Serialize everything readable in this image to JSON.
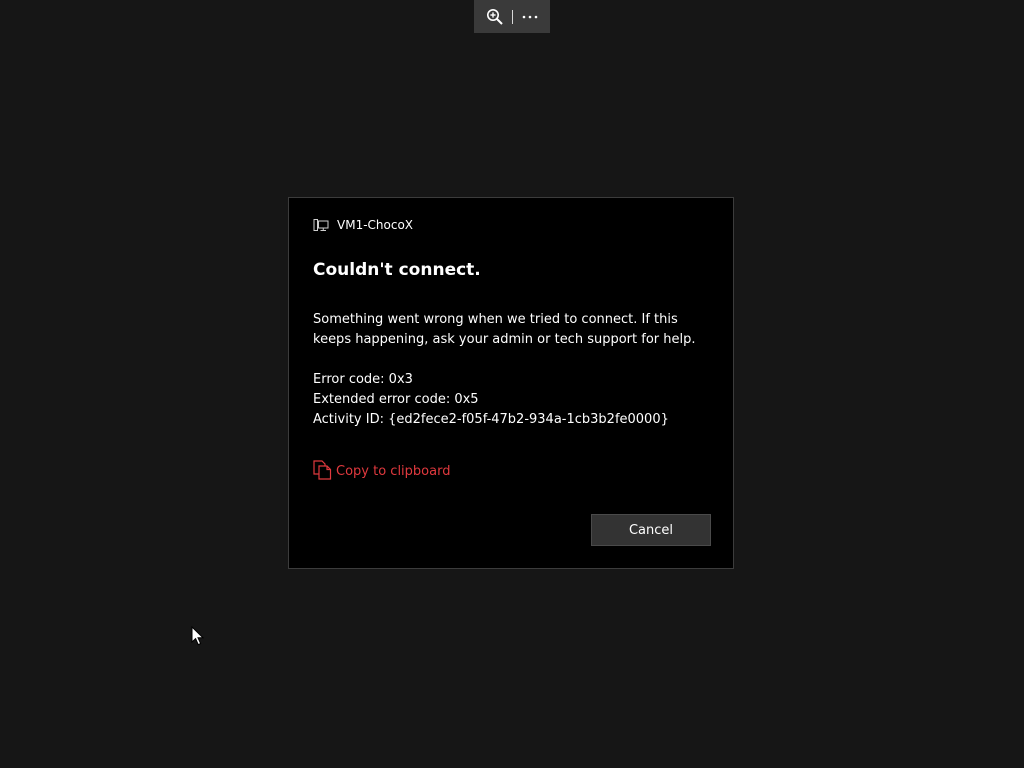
{
  "toolbar": {
    "icons": [
      "zoom-in-icon",
      "more-options-icon"
    ]
  },
  "dialog": {
    "connection_icon": "remote-pc-icon",
    "connection_name": "VM1-ChocoX",
    "title": "Couldn't connect.",
    "message": "Something went wrong when we tried to connect. If this keeps happening, ask your admin or tech support for help.",
    "error_code": "Error code: 0x3",
    "extended_error_code": "Extended error code: 0x5",
    "activity_id": "Activity ID: {ed2fece2-f05f-47b2-934a-1cb3b2fe0000}",
    "copy_icon": "copy-icon",
    "copy_label": "Copy to clipboard",
    "cancel_label": "Cancel"
  },
  "colors": {
    "background": "#161616",
    "dialog_background": "#000000",
    "accent_link": "#e0393e",
    "button_background": "#333333",
    "toolbar_background": "#3a3a3a"
  }
}
